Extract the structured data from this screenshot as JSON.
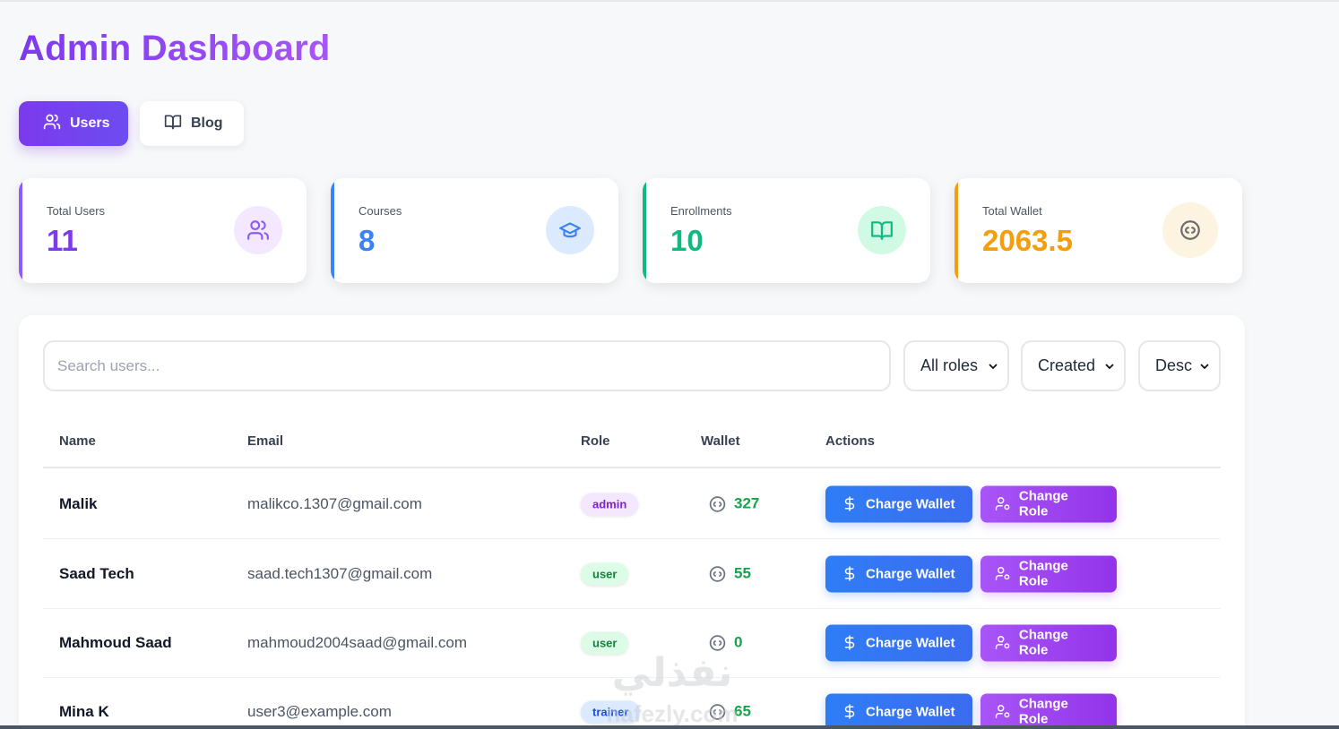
{
  "page": {
    "title": "Admin Dashboard"
  },
  "tabs": [
    {
      "label": "Users",
      "icon": "users-icon",
      "active": true
    },
    {
      "label": "Blog",
      "icon": "book-icon",
      "active": false
    }
  ],
  "stats": [
    {
      "label": "Total Users",
      "value": "11",
      "icon": "users-icon",
      "color": "#8b5cf6"
    },
    {
      "label": "Courses",
      "value": "8",
      "icon": "graduation-cap-icon",
      "color": "#3b82f6"
    },
    {
      "label": "Enrollments",
      "value": "10",
      "icon": "book-open-icon",
      "color": "#10b981"
    },
    {
      "label": "Total Wallet",
      "value": "2063.5",
      "icon": "coin-icon",
      "color": "#f59e0b"
    }
  ],
  "filters": {
    "search_placeholder": "Search users...",
    "role": "All roles",
    "sort": "Created",
    "order": "Desc"
  },
  "table": {
    "headers": {
      "name": "Name",
      "email": "Email",
      "role": "Role",
      "wallet": "Wallet",
      "actions": "Actions"
    },
    "rows": [
      {
        "name": "Malik",
        "email": "malikco.1307@gmail.com",
        "role": "admin",
        "wallet": "327"
      },
      {
        "name": "Saad Tech",
        "email": "saad.tech1307@gmail.com",
        "role": "user",
        "wallet": "55"
      },
      {
        "name": "Mahmoud Saad",
        "email": "mahmoud2004saad@gmail.com",
        "role": "user",
        "wallet": "0"
      },
      {
        "name": "Mina K",
        "email": "user3@example.com",
        "role": "trainer",
        "wallet": "65"
      }
    ],
    "charge_label": "Charge Wallet",
    "role_label": "Change Role"
  },
  "watermark": {
    "text_ar": "نفذلي",
    "text_en": "nafezly.com"
  }
}
